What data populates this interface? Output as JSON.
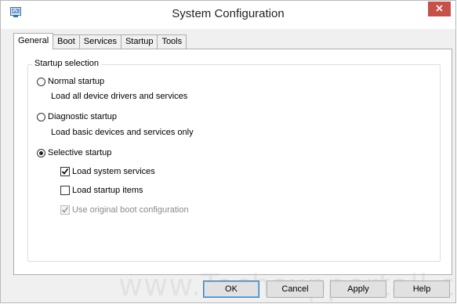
{
  "window": {
    "title": "System Configuration"
  },
  "tabs": [
    {
      "label": "General",
      "active": true
    },
    {
      "label": "Boot",
      "active": false
    },
    {
      "label": "Services",
      "active": false
    },
    {
      "label": "Startup",
      "active": false
    },
    {
      "label": "Tools",
      "active": false
    }
  ],
  "startup_selection": {
    "legend": "Startup selection",
    "normal": {
      "label": "Normal startup",
      "description": "Load all device drivers and services",
      "selected": false
    },
    "diagnostic": {
      "label": "Diagnostic startup",
      "description": "Load basic devices and services only",
      "selected": false
    },
    "selective": {
      "label": "Selective startup",
      "selected": true
    },
    "options": {
      "load_system_services": {
        "label": "Load system services",
        "checked": true,
        "enabled": true
      },
      "load_startup_items": {
        "label": "Load startup items",
        "checked": false,
        "enabled": true
      },
      "use_original_boot": {
        "label": "Use original boot configuration",
        "checked": true,
        "enabled": false
      }
    }
  },
  "buttons": {
    "ok": "OK",
    "cancel": "Cancel",
    "apply": "Apply",
    "help": "Help"
  },
  "watermark": "www.Techsupportall.com",
  "colors": {
    "close_button": "#c7504a",
    "default_button_border": "#3c7fb1"
  }
}
